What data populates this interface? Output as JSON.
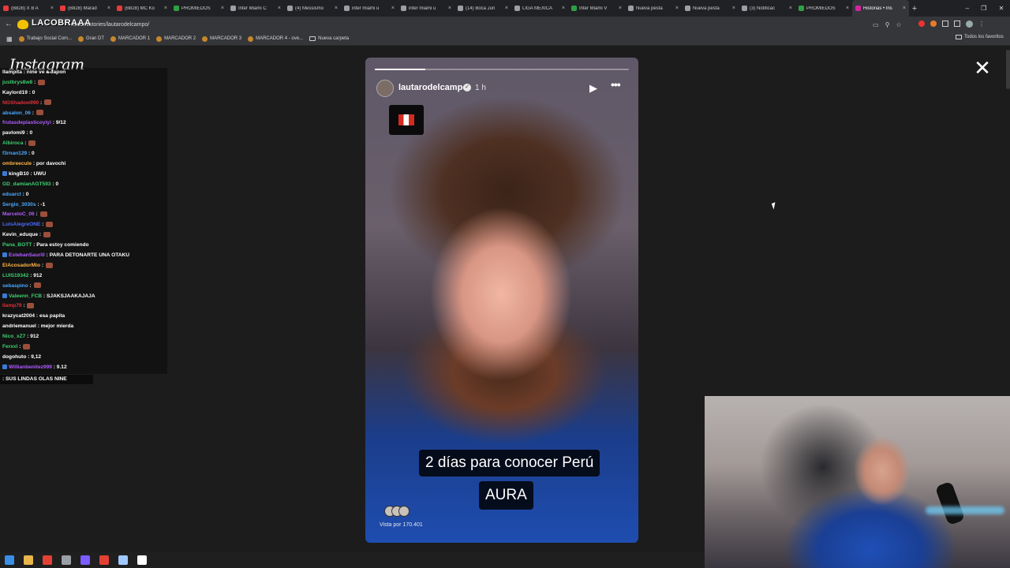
{
  "browser": {
    "tabs": [
      {
        "label": "(B828) X B A",
        "color": "#e63c3c"
      },
      {
        "label": "(B828) Marad",
        "color": "#e63c3c"
      },
      {
        "label": "(B828) MC Ko",
        "color": "#e63c3c"
      },
      {
        "label": "PROMIEDOS",
        "color": "#2ea043"
      },
      {
        "label": "Inter Miami C",
        "color": "#9aa0a6"
      },
      {
        "label": "(4) Messismo",
        "color": "#9aa0a6"
      },
      {
        "label": "inter miami u",
        "color": "#9aa0a6"
      },
      {
        "label": "inter miami u",
        "color": "#9aa0a6"
      },
      {
        "label": "(14) Boca Jun",
        "color": "#9aa0a6"
      },
      {
        "label": "LIGA MEXICA",
        "color": "#9aa0a6"
      },
      {
        "label": "Inter Miami V",
        "color": "#2ea043"
      },
      {
        "label": "Nueva pesta",
        "color": "#9aa0a6"
      },
      {
        "label": "Nueva pesta",
        "color": "#9aa0a6"
      },
      {
        "label": "(3) Notificac",
        "color": "#9aa0a6"
      },
      {
        "label": "PROMIEDOS",
        "color": "#2ea043"
      },
      {
        "label": "Historias • Ins",
        "color": "#d6249f",
        "active": true
      }
    ],
    "new_tab": "+",
    "window_controls": {
      "minimize": "–",
      "maximize": "❐",
      "close": "✕"
    },
    "url": "m.com/stories/lautarodelcampo/",
    "url_overlay_text": "LACOBRAAA",
    "bookmarks": [
      {
        "label": "Trabajo Social Com...",
        "type": "site"
      },
      {
        "label": "Gran DT",
        "type": "site"
      },
      {
        "label": "MARCADOR 1",
        "type": "site"
      },
      {
        "label": "MARCADOR 2",
        "type": "site"
      },
      {
        "label": "MARCADOR 3",
        "type": "site"
      },
      {
        "label": "MARCADOR 4 - ove...",
        "type": "site"
      },
      {
        "label": "Nueva carpeta",
        "type": "folder"
      }
    ],
    "all_bookmarks": "Todos los favoritos"
  },
  "instagram": {
    "logo": "Instagram",
    "close_icon": "✕"
  },
  "chat": {
    "messages": [
      {
        "user": "llampita",
        "color": "#ffffff",
        "text": "nine ve a Japon"
      },
      {
        "user": "justbrys8w8",
        "color": "#3cd070",
        "text": "",
        "emote": true
      },
      {
        "user": "Kaylord19",
        "color": "#ffffff",
        "text": "0"
      },
      {
        "user": "NGShadow990",
        "color": "#e0303a",
        "text": "",
        "emote": true
      },
      {
        "user": "absalon_06",
        "color": "#4aa8ff",
        "text": "",
        "emote": true
      },
      {
        "user": "frutasdeplasticoyiyi",
        "color": "#b05cff",
        "text": "9/12"
      },
      {
        "user": "pavlomi9",
        "color": "#ffffff",
        "text": "0"
      },
      {
        "user": "Albiroca",
        "color": "#3cd070",
        "text": "",
        "emote": true
      },
      {
        "user": "f3rnan129",
        "color": "#4aa8ff",
        "text": "0"
      },
      {
        "user": "ombreecule",
        "color": "#ffb347",
        "text": "por davochi"
      },
      {
        "user": "kingB10",
        "color": "#ffffff",
        "text": "UWU",
        "badge": true
      },
      {
        "user": "GD_damianAGT593",
        "color": "#3cd070",
        "text": "0"
      },
      {
        "user": "eduarct",
        "color": "#4aa8ff",
        "text": "0"
      },
      {
        "user": "Sergio_3030s",
        "color": "#4aa8ff",
        "text": "-1"
      },
      {
        "user": "MarceloC_06",
        "color": "#b05cff",
        "text": "",
        "emote": true
      },
      {
        "user": "LuisAlegreONE",
        "color": "#4a6bff",
        "text": "",
        "emote": true
      },
      {
        "user": "Kevin_eduque",
        "color": "#ffffff",
        "text": "",
        "emote": true
      },
      {
        "user": "Pana_BOTT",
        "color": "#3cd070",
        "text": "Para estoy comiendo"
      },
      {
        "user": "EstebanSauri0",
        "color": "#b05cff",
        "text": "PARA DETONARTE UNA OTAKU",
        "badge": true
      },
      {
        "user": "ElAcosadorMio",
        "color": "#ffb347",
        "text": "",
        "emote": true
      },
      {
        "user": "LUIS19342",
        "color": "#3cd070",
        "text": "912"
      },
      {
        "user": "sebaspino",
        "color": "#4aa8ff",
        "text": "",
        "emote": true
      },
      {
        "user": "Valeenn_FCB",
        "color": "#3cd070",
        "text": "SJAKSJAAKAJAJA",
        "badge": true
      },
      {
        "user": "llamp79",
        "color": "#e0303a",
        "text": "",
        "emote": true
      },
      {
        "user": "krazycat2004",
        "color": "#ffffff",
        "text": "esa papita"
      },
      {
        "user": "andriemanuel",
        "color": "#ffffff",
        "text": "mejor mierda"
      },
      {
        "user": "Nico_xZ7",
        "color": "#3cd070",
        "text": "912"
      },
      {
        "user": "Ferxxl",
        "color": "#3cd070",
        "text": "",
        "emote": true
      },
      {
        "user": "dogohuto",
        "color": "#ffffff",
        "text": "9,12"
      },
      {
        "user": "Willianbenitez999",
        "color": "#b05cff",
        "text": "9.12",
        "badge": true
      }
    ],
    "last_line": ": SUS LINDAS OLAS NINE"
  },
  "story": {
    "username": "lautarodelcampo",
    "verified_icon": "✓",
    "time": "1 h",
    "play_icon": "▶",
    "more_icon": "•••",
    "progress": 0.2,
    "caption_1": "2 días para conocer Perú",
    "caption_2": "AURA",
    "views": "Vista por 170.401"
  },
  "taskbar": {
    "icons": [
      {
        "name": "windows-start-icon",
        "color": "#3a8ee6"
      },
      {
        "name": "file-explorer-icon",
        "color": "#e8b64a"
      },
      {
        "name": "chrome-icon",
        "color": "#e34133"
      },
      {
        "name": "app-icon-1",
        "color": "#9aa0a6"
      },
      {
        "name": "app-icon-2",
        "color": "#7a5cff"
      },
      {
        "name": "app-icon-3",
        "color": "#e34133"
      },
      {
        "name": "app-icon-4",
        "color": "#a0c8ff"
      },
      {
        "name": "app-icon-5",
        "color": "#ffffff"
      }
    ]
  }
}
